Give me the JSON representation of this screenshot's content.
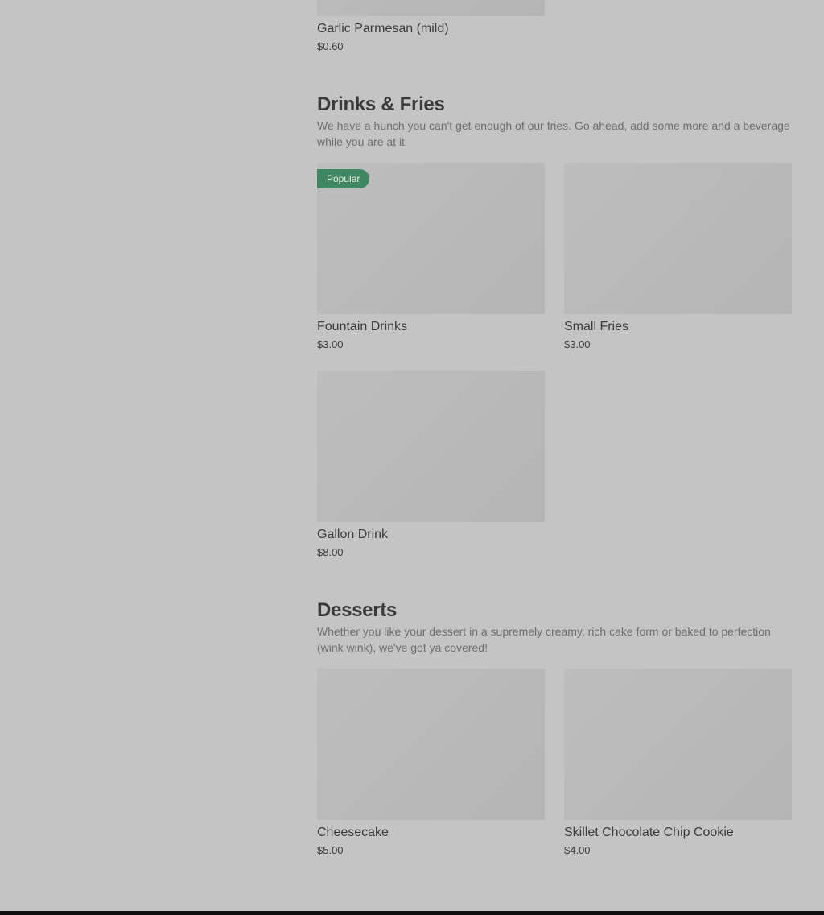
{
  "previous_item": {
    "name": "Garlic Parmesan (mild)",
    "price": "$0.60"
  },
  "sections": [
    {
      "title": "Drinks & Fries",
      "description": "We have a hunch you can't get enough of our fries. Go ahead, add some more and a beverage while you are at it",
      "items": [
        {
          "name": "Fountain Drinks",
          "price": "$3.00",
          "badge": "Popular"
        },
        {
          "name": "Small Fries",
          "price": "$3.00"
        },
        {
          "name": "Gallon Drink",
          "price": "$8.00"
        }
      ]
    },
    {
      "title": "Desserts",
      "description": "Whether you like your dessert in a supremely creamy, rich cake form or baked to perfection (wink wink), we've got ya covered!",
      "items": [
        {
          "name": "Cheesecake",
          "price": "$5.00"
        },
        {
          "name": "Skillet Chocolate Chip Cookie",
          "price": "$4.00"
        }
      ]
    }
  ],
  "colors": {
    "page_background": "#c4c4c4",
    "popular_badge": "#3f8760",
    "image_placeholder": "#b9b9b9"
  }
}
